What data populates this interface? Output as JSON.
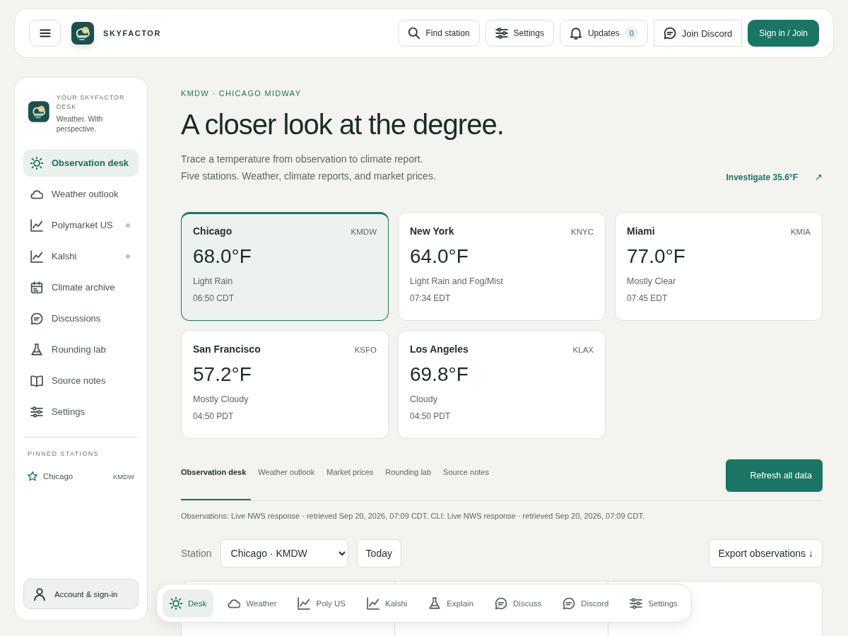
{
  "header": {
    "brand": "SKYFACTOR",
    "actions": [
      {
        "label": "Find station",
        "kind": "search"
      },
      {
        "label": "Settings",
        "kind": "settings"
      },
      {
        "label": "Updates",
        "kind": "updates",
        "count": "0"
      },
      {
        "label": "Join Discord",
        "kind": "discord"
      },
      {
        "label": "Sign in / Join",
        "kind": "primary"
      }
    ]
  },
  "sidebar": {
    "eyebrow": "YOUR SKYFACTOR DESK",
    "tagline": "Weather. With perspective.",
    "items": [
      {
        "label": "Observation desk",
        "selected": true,
        "indicator": false
      },
      {
        "label": "Weather outlook",
        "selected": false,
        "indicator": false
      },
      {
        "label": "Polymarket US",
        "selected": false,
        "indicator": true
      },
      {
        "label": "Kalshi",
        "selected": false,
        "indicator": true
      },
      {
        "label": "Climate archive",
        "selected": false,
        "indicator": false
      },
      {
        "label": "Discussions",
        "selected": false,
        "indicator": false
      },
      {
        "label": "Rounding lab",
        "selected": false,
        "indicator": false
      },
      {
        "label": "Source notes",
        "selected": false,
        "indicator": false
      },
      {
        "label": "Settings",
        "selected": false,
        "indicator": false
      }
    ],
    "pinned_heading": "PINNED STATIONS",
    "pinned": [
      {
        "name": "Chicago",
        "code": "KMDW"
      }
    ],
    "account": "Account & sign-in"
  },
  "hero": {
    "eyebrow": "KMDW · CHICAGO MIDWAY",
    "title": "A closer look at the degree.",
    "lines": [
      "Trace a temperature from observation to climate report.",
      "Five stations. Weather, climate reports, and market prices."
    ],
    "link": "Investigate 35.6°F",
    "link_arrow": "↗"
  },
  "stations": [
    {
      "city": "Chicago",
      "code": "KMDW",
      "temp": "68.0°F",
      "condition": "Light Rain",
      "time": "06:50 CDT",
      "selected": true
    },
    {
      "city": "New York",
      "code": "KNYC",
      "temp": "64.0°F",
      "condition": "Light Rain and Fog/Mist",
      "time": "07:34 EDT",
      "selected": false
    },
    {
      "city": "Miami",
      "code": "KMIA",
      "temp": "77.0°F",
      "condition": "Mostly Clear",
      "time": "07:45 EDT",
      "selected": false
    },
    {
      "city": "San Francisco",
      "code": "KSFO",
      "temp": "57.2°F",
      "condition": "Mostly Cloudy",
      "time": "04:50 PDT",
      "selected": false
    },
    {
      "city": "Los Angeles",
      "code": "KLAX",
      "temp": "69.8°F",
      "condition": "Cloudy",
      "time": "04:50 PDT",
      "selected": false
    }
  ],
  "tabs": [
    {
      "label": "Observation desk",
      "selected": true
    },
    {
      "label": "Weather outlook",
      "selected": false
    },
    {
      "label": "Market prices",
      "selected": false
    },
    {
      "label": "Rounding lab",
      "selected": false
    },
    {
      "label": "Source notes",
      "selected": false
    }
  ],
  "refresh_button": "Refresh all data",
  "source_note": "Observations: Live NWS response · retrieved Sep 20, 2026, 07:09 CDT. CLI: Live NWS response · retrieved Sep 20, 2026, 07:09 CDT.",
  "controls": {
    "station_label": "Station",
    "station_value": "Chicago · KMDW",
    "today_button": "Today",
    "export_button": "Export observations ↓"
  },
  "bottom_nav": [
    {
      "label": "Desk",
      "selected": true
    },
    {
      "label": "Weather",
      "selected": false
    },
    {
      "label": "Poly US",
      "selected": false
    },
    {
      "label": "Kalshi",
      "selected": false
    },
    {
      "label": "Explain",
      "selected": false
    },
    {
      "label": "Discuss",
      "selected": false
    },
    {
      "label": "Discord",
      "selected": false
    },
    {
      "label": "Settings",
      "selected": false
    }
  ]
}
